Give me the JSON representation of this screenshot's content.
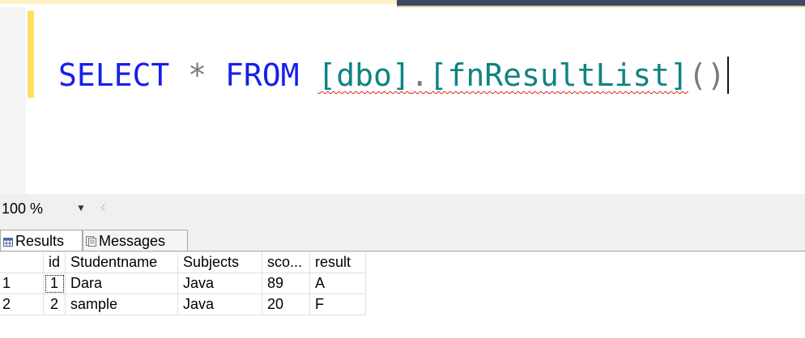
{
  "editor": {
    "query": {
      "select_kw": "SELECT",
      "star": "*",
      "from_kw": "FROM",
      "schema": "[dbo]",
      "dot": ".",
      "function": "[fnResultList]",
      "parens": "()"
    }
  },
  "zoom": {
    "value": "100 %"
  },
  "tabs": {
    "results_label": "Results",
    "messages_label": "Messages"
  },
  "grid": {
    "headers": [
      "id",
      "Studentname",
      "Subjects",
      "sco...",
      "result"
    ],
    "rows": [
      {
        "rownum": "1",
        "id": "1",
        "Studentname": "Dara",
        "Subjects": "Java",
        "score": "89",
        "result": "A"
      },
      {
        "rownum": "2",
        "id": "2",
        "Studentname": "sample",
        "Subjects": "Java",
        "score": "20",
        "result": "F"
      }
    ]
  },
  "colors": {
    "keyword": "#1520ea",
    "object": "#0f8383",
    "operator": "#7a7a7a",
    "change_marker": "#ffe064",
    "squiggle": "#e02020"
  }
}
